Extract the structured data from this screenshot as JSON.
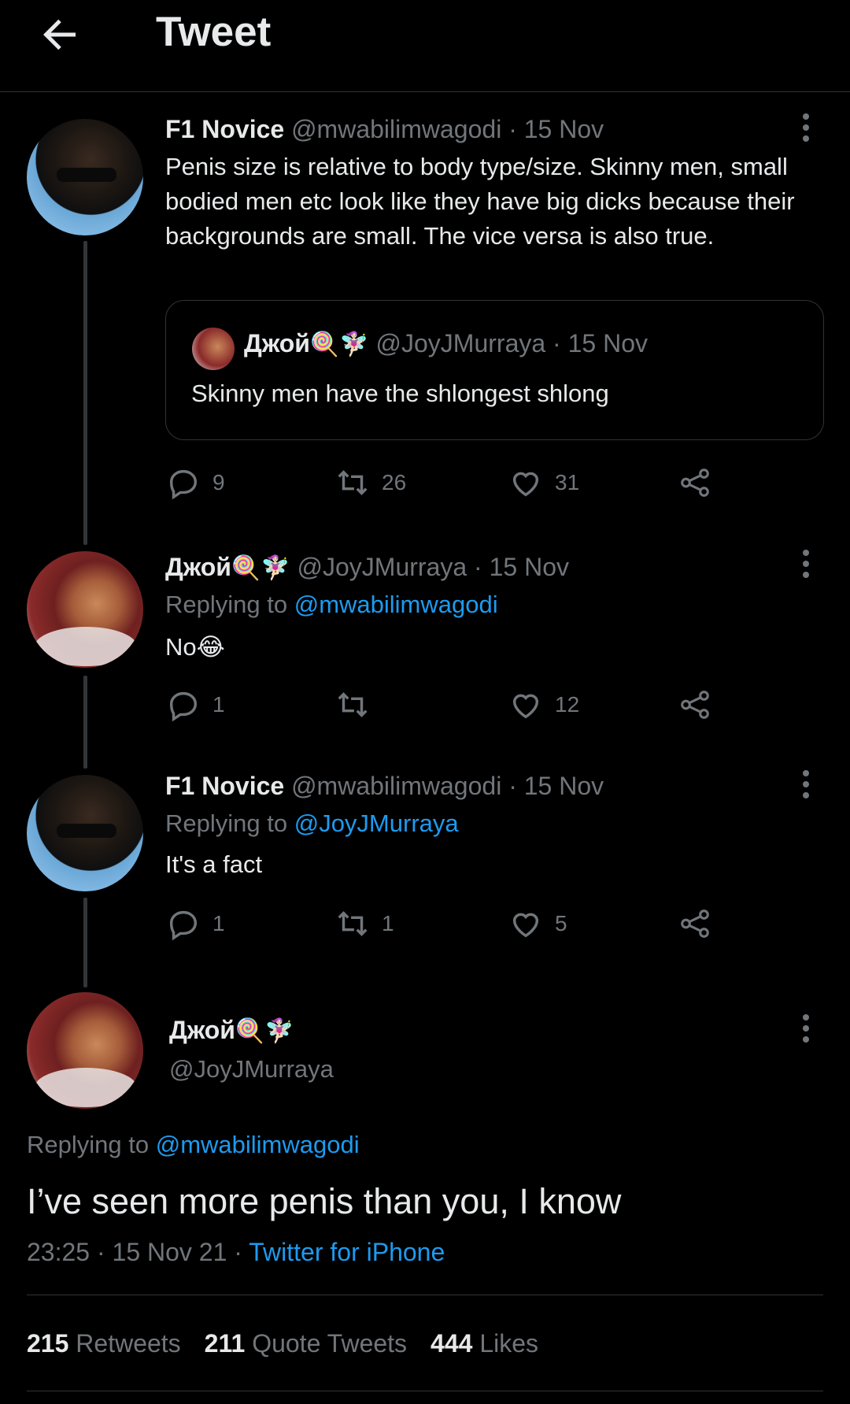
{
  "header": {
    "title": "Tweet"
  },
  "tweets": [
    {
      "name": "F1 Novice",
      "handle": "@mwabilimwagodi",
      "date": "· 15 Nov",
      "text": "Penis size is relative to body type/size. Skinny men, small bodied men etc look like they have big dicks because their backgrounds are small. The vice versa is also true.",
      "quote": {
        "name": "Джой",
        "emoji": "🍭🧚🏻‍♀️",
        "handle": "@JoyJMurraya",
        "date": "· 15 Nov",
        "text": "Skinny men have the shlongest shlong"
      },
      "replies": "9",
      "retweets": "26",
      "likes": "31"
    },
    {
      "name": "Джой",
      "emoji": "🍭🧚🏻‍♀️",
      "handle": "@JoyJMurraya",
      "date": "· 15 Nov",
      "replying_label": "Replying to",
      "replying_to": "@mwabilimwagodi",
      "text": "No😂",
      "replies": "1",
      "retweets": "",
      "likes": "12"
    },
    {
      "name": "F1 Novice",
      "handle": "@mwabilimwagodi",
      "date": "· 15 Nov",
      "replying_label": "Replying to",
      "replying_to": "@JoyJMurraya",
      "text": "It's a fact",
      "replies": "1",
      "retweets": "1",
      "likes": "5"
    }
  ],
  "main": {
    "name": "Джой",
    "emoji": "🍭🧚🏻‍♀️",
    "handle": "@JoyJMurraya",
    "replying_label": "Replying to",
    "replying_to": "@mwabilimwagodi",
    "text": "I’ve seen more penis than you, I know",
    "time": "23:25 · 15 Nov 21 ·",
    "source": "Twitter for iPhone",
    "retweets_count": "215",
    "retweets_label": "Retweets",
    "quotes_count": "211",
    "quotes_label": "Quote Tweets",
    "likes_count": "444",
    "likes_label": "Likes"
  },
  "colors": {
    "accent": "#1d9bf0",
    "background": "#000000",
    "muted": "#71767b"
  }
}
